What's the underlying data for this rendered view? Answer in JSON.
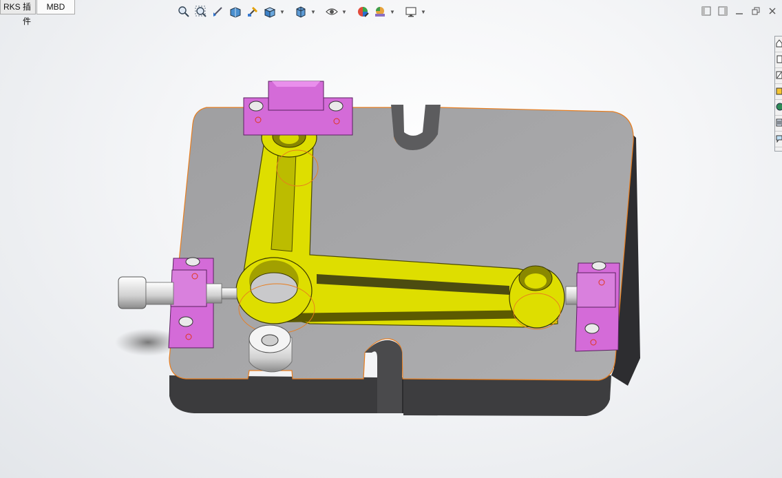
{
  "tabs": [
    {
      "label": "RKS 插件"
    },
    {
      "label": "MBD"
    }
  ],
  "heads_up_toolbar": {
    "buttons": [
      {
        "icon": "zoom-to-fit-icon"
      },
      {
        "icon": "zoom-to-area-icon"
      },
      {
        "icon": "previous-view-icon"
      },
      {
        "icon": "section-view-icon"
      },
      {
        "icon": "dynamic-annotation-icon"
      },
      {
        "icon": "view-orientation-icon",
        "dropdown": true
      },
      {
        "icon": "display-style-icon",
        "dropdown": true
      },
      {
        "icon": "hide-show-items-icon",
        "dropdown": true
      },
      {
        "icon": "edit-appearance-icon"
      },
      {
        "icon": "apply-scene-icon",
        "dropdown": true
      },
      {
        "icon": "view-settings-icon",
        "dropdown": true
      }
    ]
  },
  "window_controls": [
    {
      "icon": "tile-left-icon"
    },
    {
      "icon": "tile-right-icon"
    },
    {
      "icon": "minimize-icon"
    },
    {
      "icon": "restore-icon"
    },
    {
      "icon": "close-icon"
    }
  ],
  "task_pane": [
    {
      "icon": "home-icon"
    },
    {
      "icon": "resources-icon"
    },
    {
      "icon": "design-library-icon"
    },
    {
      "icon": "file-explorer-icon"
    },
    {
      "icon": "appearances-icon"
    },
    {
      "icon": "custom-properties-icon"
    },
    {
      "icon": "forum-icon"
    }
  ],
  "model": {
    "colors": {
      "base_top": "#a6a6a8",
      "base_side": "#3a3a3c",
      "fixture_arm": "#e0e000",
      "fixture_dark": "#6f6c00",
      "clamp_block": "#d46bd8",
      "clamp_dark": "#9a3ea0",
      "edge_highlight": "#e87d1e",
      "screw": "#e8e8e8"
    }
  }
}
